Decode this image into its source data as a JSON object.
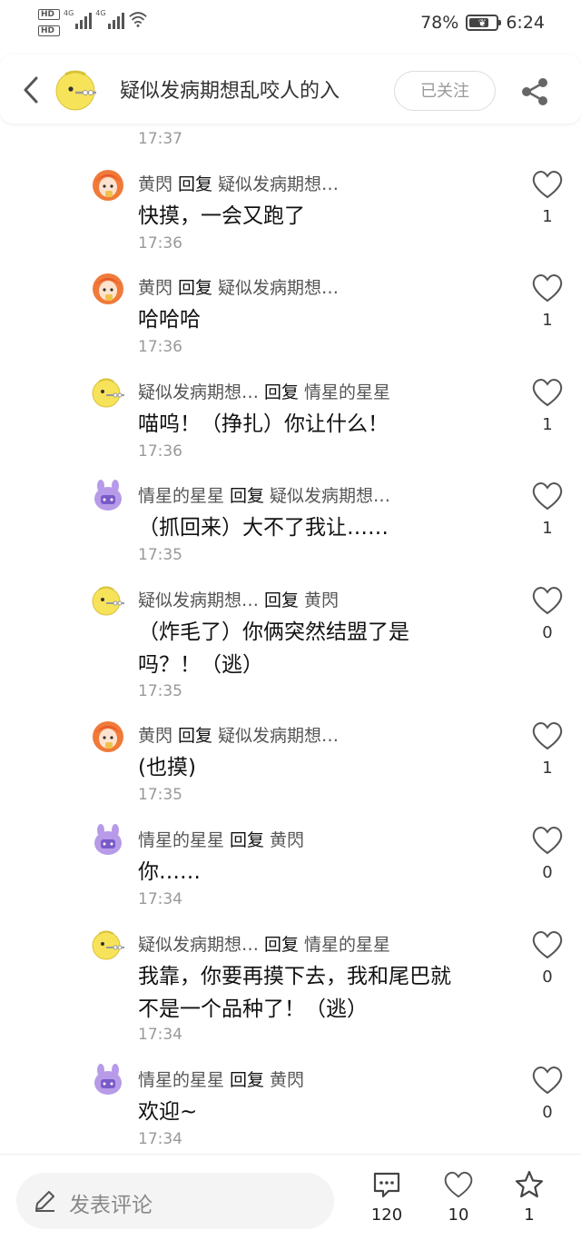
{
  "status": {
    "sim1": "HD",
    "sim2": "HD",
    "net1": "4G",
    "net2": "4G",
    "battery_percent": "78%",
    "battery_level": 0.78,
    "time": "6:24"
  },
  "header": {
    "title": "疑似发病期想乱咬人的入",
    "follow_label": "已关注",
    "back_icon": "chevron-left-icon",
    "share_icon": "share-icon"
  },
  "top_time": "17:37",
  "comments": [
    {
      "author": "黄閃",
      "reply": "回复",
      "target": "疑似发病期想…",
      "text": "快摸，一会又跑了",
      "time": "17:36",
      "likes": "1",
      "avatar": "orange-girl-avatar"
    },
    {
      "author": "黄閃",
      "reply": "回复",
      "target": "疑似发病期想…",
      "text": "哈哈哈",
      "time": "17:36",
      "likes": "1",
      "avatar": "orange-girl-avatar"
    },
    {
      "author": "疑似发病期想…",
      "reply": "回复",
      "target": "情星的星星",
      "text": "喵呜！（挣扎）你让什么！",
      "time": "17:36",
      "likes": "1",
      "avatar": "yellow-ball-avatar"
    },
    {
      "author": "情星的星星",
      "reply": "回复",
      "target": "疑似发病期想…",
      "text": "（抓回来）大不了我让……",
      "time": "17:35",
      "likes": "1",
      "avatar": "purple-bunny-avatar"
    },
    {
      "author": "疑似发病期想…",
      "reply": "回复",
      "target": "黄閃",
      "text": "（炸毛了）你俩突然结盟了是吗？！（逃）",
      "time": "17:35",
      "likes": "0",
      "avatar": "yellow-ball-avatar"
    },
    {
      "author": "黄閃",
      "reply": "回复",
      "target": "疑似发病期想…",
      "text": "(也摸)",
      "time": "17:35",
      "likes": "1",
      "avatar": "orange-girl-avatar"
    },
    {
      "author": "情星的星星",
      "reply": "回复",
      "target": "黄閃",
      "text": "你……",
      "time": "17:34",
      "likes": "0",
      "avatar": "purple-bunny-avatar"
    },
    {
      "author": "疑似发病期想…",
      "reply": "回复",
      "target": "情星的星星",
      "text": "我靠，你要再摸下去，我和尾巴就不是一个品种了！（逃）",
      "time": "17:34",
      "likes": "0",
      "avatar": "yellow-ball-avatar"
    },
    {
      "author": "情星的星星",
      "reply": "回复",
      "target": "黄閃",
      "text": "欢迎~",
      "time": "17:34",
      "likes": "0",
      "avatar": "purple-bunny-avatar"
    }
  ],
  "bottom": {
    "input_placeholder": "发表评论",
    "comments_count": "120",
    "likes_count": "10",
    "favorites_count": "1"
  }
}
